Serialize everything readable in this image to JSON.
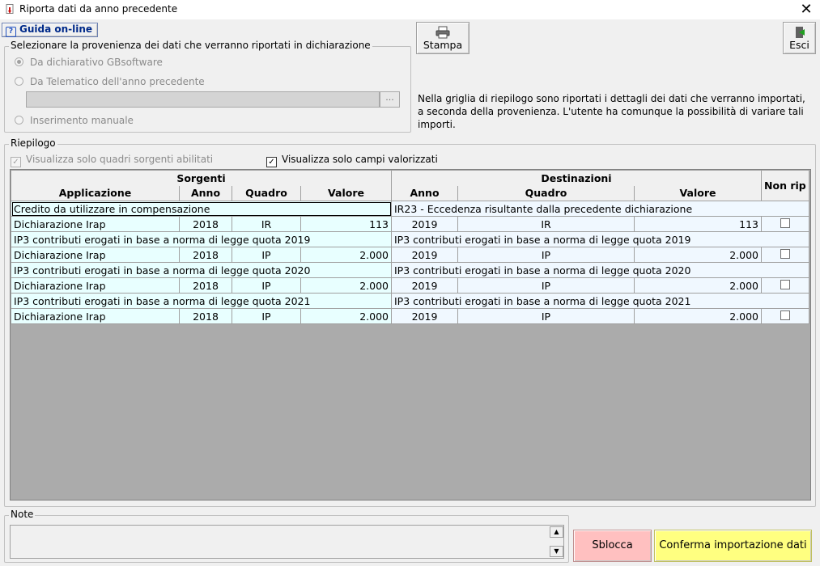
{
  "window": {
    "title": "Riporta dati da anno precedente"
  },
  "toolbar": {
    "guida_label": "Guida on-line",
    "stampa_label": "Stampa",
    "esci_label": "Esci"
  },
  "provenienza": {
    "title": "Selezionare la provenienza dei dati che verranno riportati in dichiarazione",
    "options": [
      {
        "label": "Da dichiarativo GBsoftware",
        "selected": true
      },
      {
        "label": "Da Telematico dell'anno precedente",
        "selected": false
      },
      {
        "label": "Inserimento manuale",
        "selected": false
      }
    ],
    "browse_label": "..."
  },
  "info_text": "Nella griglia di riepilogo sono riportati i dettagli dei dati che verranno importati, a seconda della provenienza. L'utente ha comunque la possibilità di variare tali importi.",
  "riepilogo": {
    "title": "Riepilogo",
    "check_quadri": {
      "label": "Visualizza solo quadri sorgenti abilitati",
      "checked": true,
      "enabled": false
    },
    "check_campi": {
      "label": "Visualizza solo campi valorizzati",
      "checked": true,
      "enabled": true
    }
  },
  "grid": {
    "group_sorgenti": "Sorgenti",
    "group_destinazioni": "Destinazioni",
    "group_nonrip": "Non rip",
    "columns": {
      "applicazione": "Applicazione",
      "anno_src": "Anno",
      "quadro_src": "Quadro",
      "valore_src": "Valore",
      "anno_dst": "Anno",
      "quadro_dst": "Quadro",
      "valore_dst": "Valore"
    },
    "records": [
      {
        "src_desc": "Credito da utilizzare in compensazione",
        "dst_desc": "IR23 - Eccedenza risultante dalla precedente dichiarazione",
        "applicazione": "Dichiarazione Irap",
        "anno_src": "2018",
        "quadro_src": "IR",
        "valore_src": "113",
        "anno_dst": "2019",
        "quadro_dst": "IR",
        "valore_dst": "113"
      },
      {
        "src_desc": "IP3 contributi erogati in base a norma di legge quota 2019",
        "dst_desc": "IP3 contributi erogati in base a norma di legge quota 2019",
        "applicazione": "Dichiarazione Irap",
        "anno_src": "2018",
        "quadro_src": "IP",
        "valore_src": "2.000",
        "anno_dst": "2019",
        "quadro_dst": "IP",
        "valore_dst": "2.000"
      },
      {
        "src_desc": "IP3 contributi erogati in base a norma di legge quota 2020",
        "dst_desc": "IP3 contributi erogati in base a norma di legge quota 2020",
        "applicazione": "Dichiarazione Irap",
        "anno_src": "2018",
        "quadro_src": "IP",
        "valore_src": "2.000",
        "anno_dst": "2019",
        "quadro_dst": "IP",
        "valore_dst": "2.000"
      },
      {
        "src_desc": "IP3 contributi erogati in base a norma di legge quota 2021",
        "dst_desc": "IP3 contributi erogati in base a norma di legge quota 2021",
        "applicazione": "Dichiarazione Irap",
        "anno_src": "2018",
        "quadro_src": "IP",
        "valore_src": "2.000",
        "anno_dst": "2019",
        "quadro_dst": "IP",
        "valore_dst": "2.000"
      }
    ]
  },
  "note": {
    "title": "Note"
  },
  "buttons": {
    "sblocca": "Sblocca",
    "conferma": "Conferma importazione dati"
  },
  "colors": {
    "sblocca_bg": "#ffc0c0",
    "conferma_bg": "#ffff80",
    "grid_bg": "#ababab",
    "src_cell_bg": "#e8ffff",
    "dst_cell_bg": "#f0f8ff"
  },
  "icons": {
    "title": "app-icon",
    "close": "close-icon",
    "guida": "help-icon",
    "stampa": "printer-icon",
    "esci": "exit-door-icon"
  }
}
